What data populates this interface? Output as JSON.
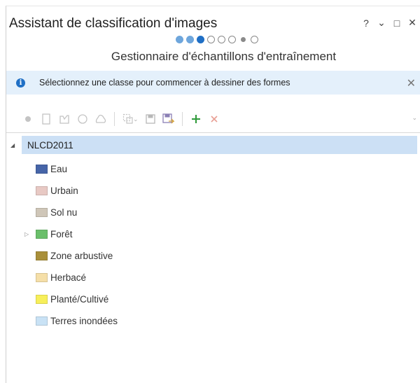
{
  "window": {
    "title": "Assistant de classification d'images",
    "help": "?",
    "menu": "⌄",
    "restore": "□",
    "close": "✕"
  },
  "wizard": {
    "steps": [
      "done",
      "done",
      "current",
      "todo",
      "todo",
      "todo",
      "small",
      "todo"
    ],
    "subtitle": "Gestionnaire d'échantillons d'entraînement"
  },
  "infobar": {
    "message": "Sélectionnez une classe pour commencer à dessiner des formes",
    "close": "✕"
  },
  "toolbar": {
    "icons": [
      "point-icon",
      "rectangle-icon",
      "polygon-icon",
      "circle-icon",
      "freehand-icon",
      "select-icon",
      "save-icon",
      "save-as-icon",
      "add-icon",
      "remove-icon"
    ],
    "add_color": "#2e9a3a",
    "remove_color": "#e07a6a"
  },
  "tree": {
    "root": "NLCD2011",
    "classes": [
      {
        "label": "Eau",
        "color": "#4665a8",
        "expandable": false
      },
      {
        "label": "Urbain",
        "color": "#e8c9c4",
        "expandable": false
      },
      {
        "label": "Sol nu",
        "color": "#cfc6b8",
        "expandable": false
      },
      {
        "label": "Forêt",
        "color": "#6abf6a",
        "expandable": true
      },
      {
        "label": "Zone arbustive",
        "color": "#a98f3a",
        "expandable": false
      },
      {
        "label": "Herbacé",
        "color": "#f5dfa8",
        "expandable": false
      },
      {
        "label": "Planté/Cultivé",
        "color": "#f7ef5a",
        "expandable": false
      },
      {
        "label": "Terres inondées",
        "color": "#c9e2f5",
        "expandable": false
      }
    ]
  }
}
